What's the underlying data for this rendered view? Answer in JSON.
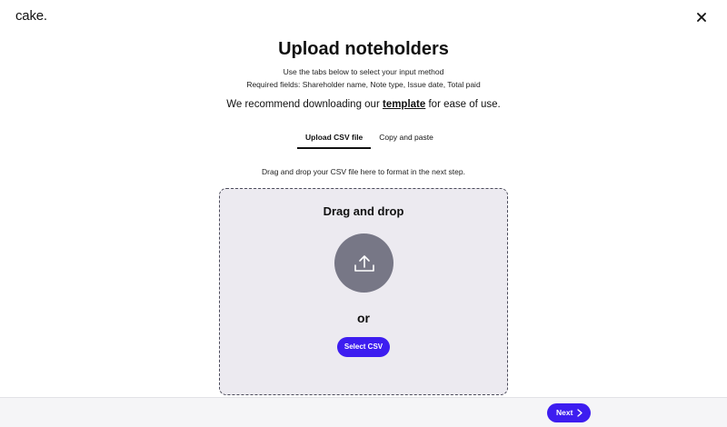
{
  "app": {
    "logo_text": "cake."
  },
  "header": {
    "close_icon": "close-icon"
  },
  "page": {
    "title": "Upload noteholders",
    "subtitle_line1": "Use the tabs below to select your input method",
    "subtitle_line2": "Required fields: Shareholder name, Note type, Issue date, Total paid",
    "recommend_prefix": "We recommend downloading our ",
    "recommend_link": "template",
    "recommend_suffix": " for ease of use."
  },
  "tabs": [
    {
      "label": "Upload CSV file",
      "active": true
    },
    {
      "label": "Copy and paste",
      "active": false
    }
  ],
  "upload": {
    "hint": "Drag and drop your CSV file here to format in the next step.",
    "dropzone_title": "Drag and drop",
    "upload_icon": "upload-icon",
    "or_text": "or",
    "select_button": "Select CSV"
  },
  "footer": {
    "next_button": "Next",
    "next_icon": "chevron-right-icon"
  },
  "colors": {
    "accent": "#3d1df0",
    "dropzone_bg": "#eceaf0",
    "upload_circle": "#777786",
    "footer_bg": "#f5f5f7"
  }
}
